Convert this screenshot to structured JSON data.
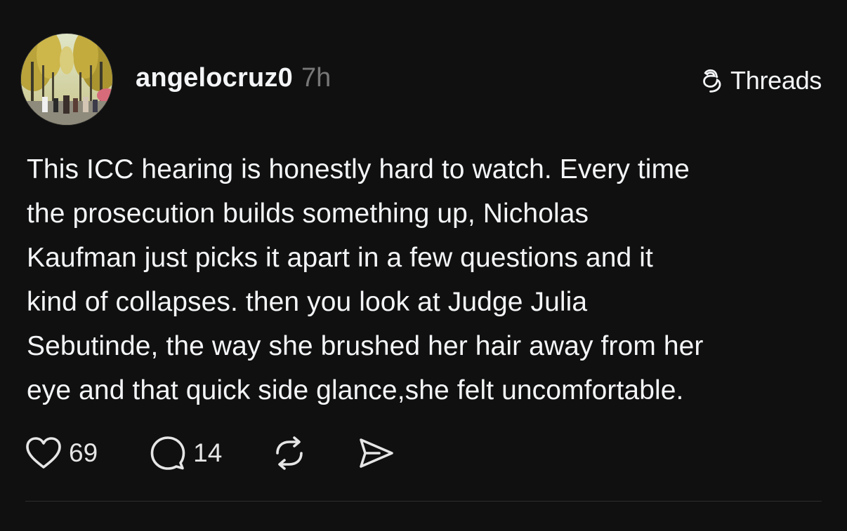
{
  "post": {
    "username": "angelocruz0",
    "time": "7h",
    "brand": "Threads",
    "avatar": {
      "icon": "profile-photo-ginkgo-trees"
    },
    "text": "This ICC hearing is honestly hard to watch. Every time\nthe prosecution builds something up, Nicholas\nKaufman just picks it apart in a few questions and it\nkind of collapses. then you look at Judge Julia\nSebutinde, the way she brushed her hair away from her\neye and that quick side glance,she felt uncomfortable.",
    "actions": {
      "like_count": "69",
      "reply_count": "14",
      "like_icon": "heart-icon",
      "reply_icon": "speech-bubble-icon",
      "repost_icon": "repost-icon",
      "share_icon": "send-icon"
    }
  },
  "colors": {
    "background": "#101010",
    "text_primary": "#f3f5f7",
    "text_secondary": "#777777",
    "divider": "#2e2e2e"
  }
}
